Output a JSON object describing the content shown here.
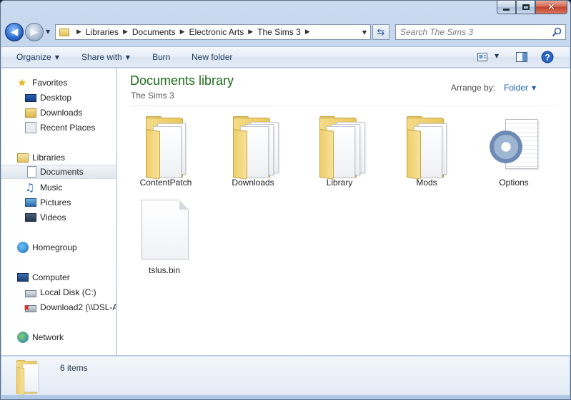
{
  "address": {
    "crumbs": [
      "Libraries",
      "Documents",
      "Electronic Arts",
      "The Sims 3"
    ]
  },
  "search": {
    "placeholder": "Search The Sims 3"
  },
  "toolbar": {
    "organize": "Organize",
    "share_with": "Share with",
    "burn": "Burn",
    "new_folder": "New folder"
  },
  "sidebar": {
    "favorites": "Favorites",
    "desktop": "Desktop",
    "downloads": "Downloads",
    "recent_places": "Recent Places",
    "libraries": "Libraries",
    "documents": "Documents",
    "music": "Music",
    "pictures": "Pictures",
    "videos": "Videos",
    "homegroup": "Homegroup",
    "computer": "Computer",
    "local_disk": "Local Disk (C:)",
    "download2": "Download2 (\\\\DSL-A",
    "network": "Network"
  },
  "library": {
    "title": "Documents library",
    "subtitle": "The Sims 3",
    "arrange_label": "Arrange by:",
    "arrange_value": "Folder"
  },
  "items": [
    {
      "name": "ContentPatch",
      "type": "folder"
    },
    {
      "name": "Downloads",
      "type": "folder"
    },
    {
      "name": "Library",
      "type": "folder"
    },
    {
      "name": "Mods",
      "type": "folder"
    },
    {
      "name": "Options",
      "type": "config"
    },
    {
      "name": "tslus.bin",
      "type": "file"
    }
  ],
  "details": {
    "count": "6 items"
  }
}
